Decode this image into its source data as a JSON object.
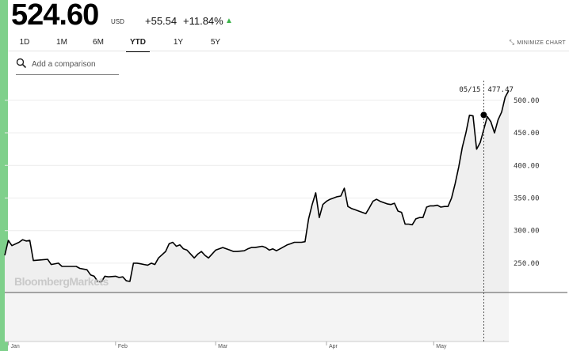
{
  "quote": {
    "price": "524.60",
    "currency": "USD",
    "change": "+55.54",
    "change_pct": "+11.84%",
    "direction_icon": "triangle-up-icon",
    "up_color": "#3cb34a"
  },
  "tabs": [
    {
      "label": "1D",
      "active": false
    },
    {
      "label": "1M",
      "active": false
    },
    {
      "label": "6M",
      "active": false
    },
    {
      "label": "YTD",
      "active": true
    },
    {
      "label": "1Y",
      "active": false
    },
    {
      "label": "5Y",
      "active": false
    }
  ],
  "minimize_label": "MINIMIZE CHART",
  "search": {
    "placeholder": "Add a comparison",
    "value": ""
  },
  "watermark": "BloombergMarkets",
  "accent_color": "#7fd08b",
  "chart_data": {
    "type": "area",
    "y_ticks": [
      "500.00",
      "450.00",
      "400.00",
      "350.00",
      "300.00",
      "250.00"
    ],
    "y_tick_values": [
      500,
      450,
      400,
      350,
      300,
      250
    ],
    "ylim": [
      205,
      535
    ],
    "x_labels": [
      "Jan",
      "Feb",
      "Mar",
      "Apr",
      "May"
    ],
    "x_label_days": [
      2,
      32,
      60,
      91,
      121
    ],
    "xlim": [
      1,
      140
    ],
    "tooltip": {
      "date": "05/15",
      "value": "477.47",
      "day": 135
    },
    "series": [
      {
        "values": [
          [
            1,
            262
          ],
          [
            2,
            285
          ],
          [
            3,
            277
          ],
          [
            5,
            282
          ],
          [
            6,
            286
          ],
          [
            7,
            284
          ],
          [
            8,
            285
          ],
          [
            9,
            254
          ],
          [
            11,
            255
          ],
          [
            13,
            256
          ],
          [
            14,
            248
          ],
          [
            16,
            250
          ],
          [
            17,
            245
          ],
          [
            19,
            245
          ],
          [
            21,
            245
          ],
          [
            22,
            242
          ],
          [
            24,
            240
          ],
          [
            25,
            232
          ],
          [
            26,
            230
          ],
          [
            27,
            222
          ],
          [
            28,
            221
          ],
          [
            29,
            230
          ],
          [
            30,
            229
          ],
          [
            32,
            230
          ],
          [
            33,
            228
          ],
          [
            34,
            229
          ],
          [
            35,
            223
          ],
          [
            36,
            222
          ],
          [
            37,
            250
          ],
          [
            38,
            250
          ],
          [
            39,
            249
          ],
          [
            40,
            248
          ],
          [
            41,
            247
          ],
          [
            42,
            250
          ],
          [
            43,
            248
          ],
          [
            44,
            258
          ],
          [
            46,
            268
          ],
          [
            47,
            280
          ],
          [
            48,
            282
          ],
          [
            49,
            276
          ],
          [
            50,
            278
          ],
          [
            51,
            272
          ],
          [
            52,
            270
          ],
          [
            53,
            264
          ],
          [
            54,
            258
          ],
          [
            55,
            264
          ],
          [
            56,
            268
          ],
          [
            57,
            262
          ],
          [
            58,
            258
          ],
          [
            60,
            270
          ],
          [
            61,
            272
          ],
          [
            62,
            274
          ],
          [
            63,
            272
          ],
          [
            64,
            270
          ],
          [
            65,
            268
          ],
          [
            66,
            268
          ],
          [
            68,
            269
          ],
          [
            69,
            272
          ],
          [
            70,
            274
          ],
          [
            71,
            274
          ],
          [
            72,
            275
          ],
          [
            73,
            276
          ],
          [
            74,
            274
          ],
          [
            75,
            270
          ],
          [
            76,
            272
          ],
          [
            77,
            269
          ],
          [
            78,
            272
          ],
          [
            79,
            275
          ],
          [
            80,
            278
          ],
          [
            81,
            280
          ],
          [
            82,
            282
          ],
          [
            84,
            282
          ],
          [
            85,
            283
          ],
          [
            86,
            318
          ],
          [
            87,
            340
          ],
          [
            88,
            358
          ],
          [
            89,
            320
          ],
          [
            90,
            340
          ],
          [
            91,
            345
          ],
          [
            92,
            348
          ],
          [
            94,
            352
          ],
          [
            95,
            353
          ],
          [
            96,
            365
          ],
          [
            97,
            337
          ],
          [
            98,
            334
          ],
          [
            99,
            332
          ],
          [
            100,
            330
          ],
          [
            101,
            328
          ],
          [
            102,
            326
          ],
          [
            103,
            335
          ],
          [
            104,
            345
          ],
          [
            105,
            348
          ],
          [
            106,
            345
          ],
          [
            107,
            343
          ],
          [
            108,
            341
          ],
          [
            109,
            340
          ],
          [
            110,
            342
          ],
          [
            111,
            330
          ],
          [
            112,
            328
          ],
          [
            113,
            310
          ],
          [
            114,
            310
          ],
          [
            115,
            309
          ],
          [
            116,
            318
          ],
          [
            117,
            320
          ],
          [
            118,
            320
          ],
          [
            119,
            336
          ],
          [
            120,
            338
          ],
          [
            121,
            338
          ],
          [
            122,
            339
          ],
          [
            123,
            336
          ],
          [
            124,
            337
          ],
          [
            125,
            337
          ],
          [
            126,
            350
          ],
          [
            127,
            372
          ],
          [
            128,
            398
          ],
          [
            129,
            428
          ],
          [
            130,
            450
          ],
          [
            131,
            477
          ],
          [
            132,
            476
          ],
          [
            133,
            425
          ],
          [
            134,
            435
          ],
          [
            135,
            455
          ],
          [
            136,
            475
          ],
          [
            137,
            467
          ],
          [
            138,
            450
          ],
          [
            139,
            470
          ],
          [
            140,
            482
          ],
          [
            141,
            505
          ],
          [
            142,
            515
          ]
        ]
      }
    ]
  }
}
